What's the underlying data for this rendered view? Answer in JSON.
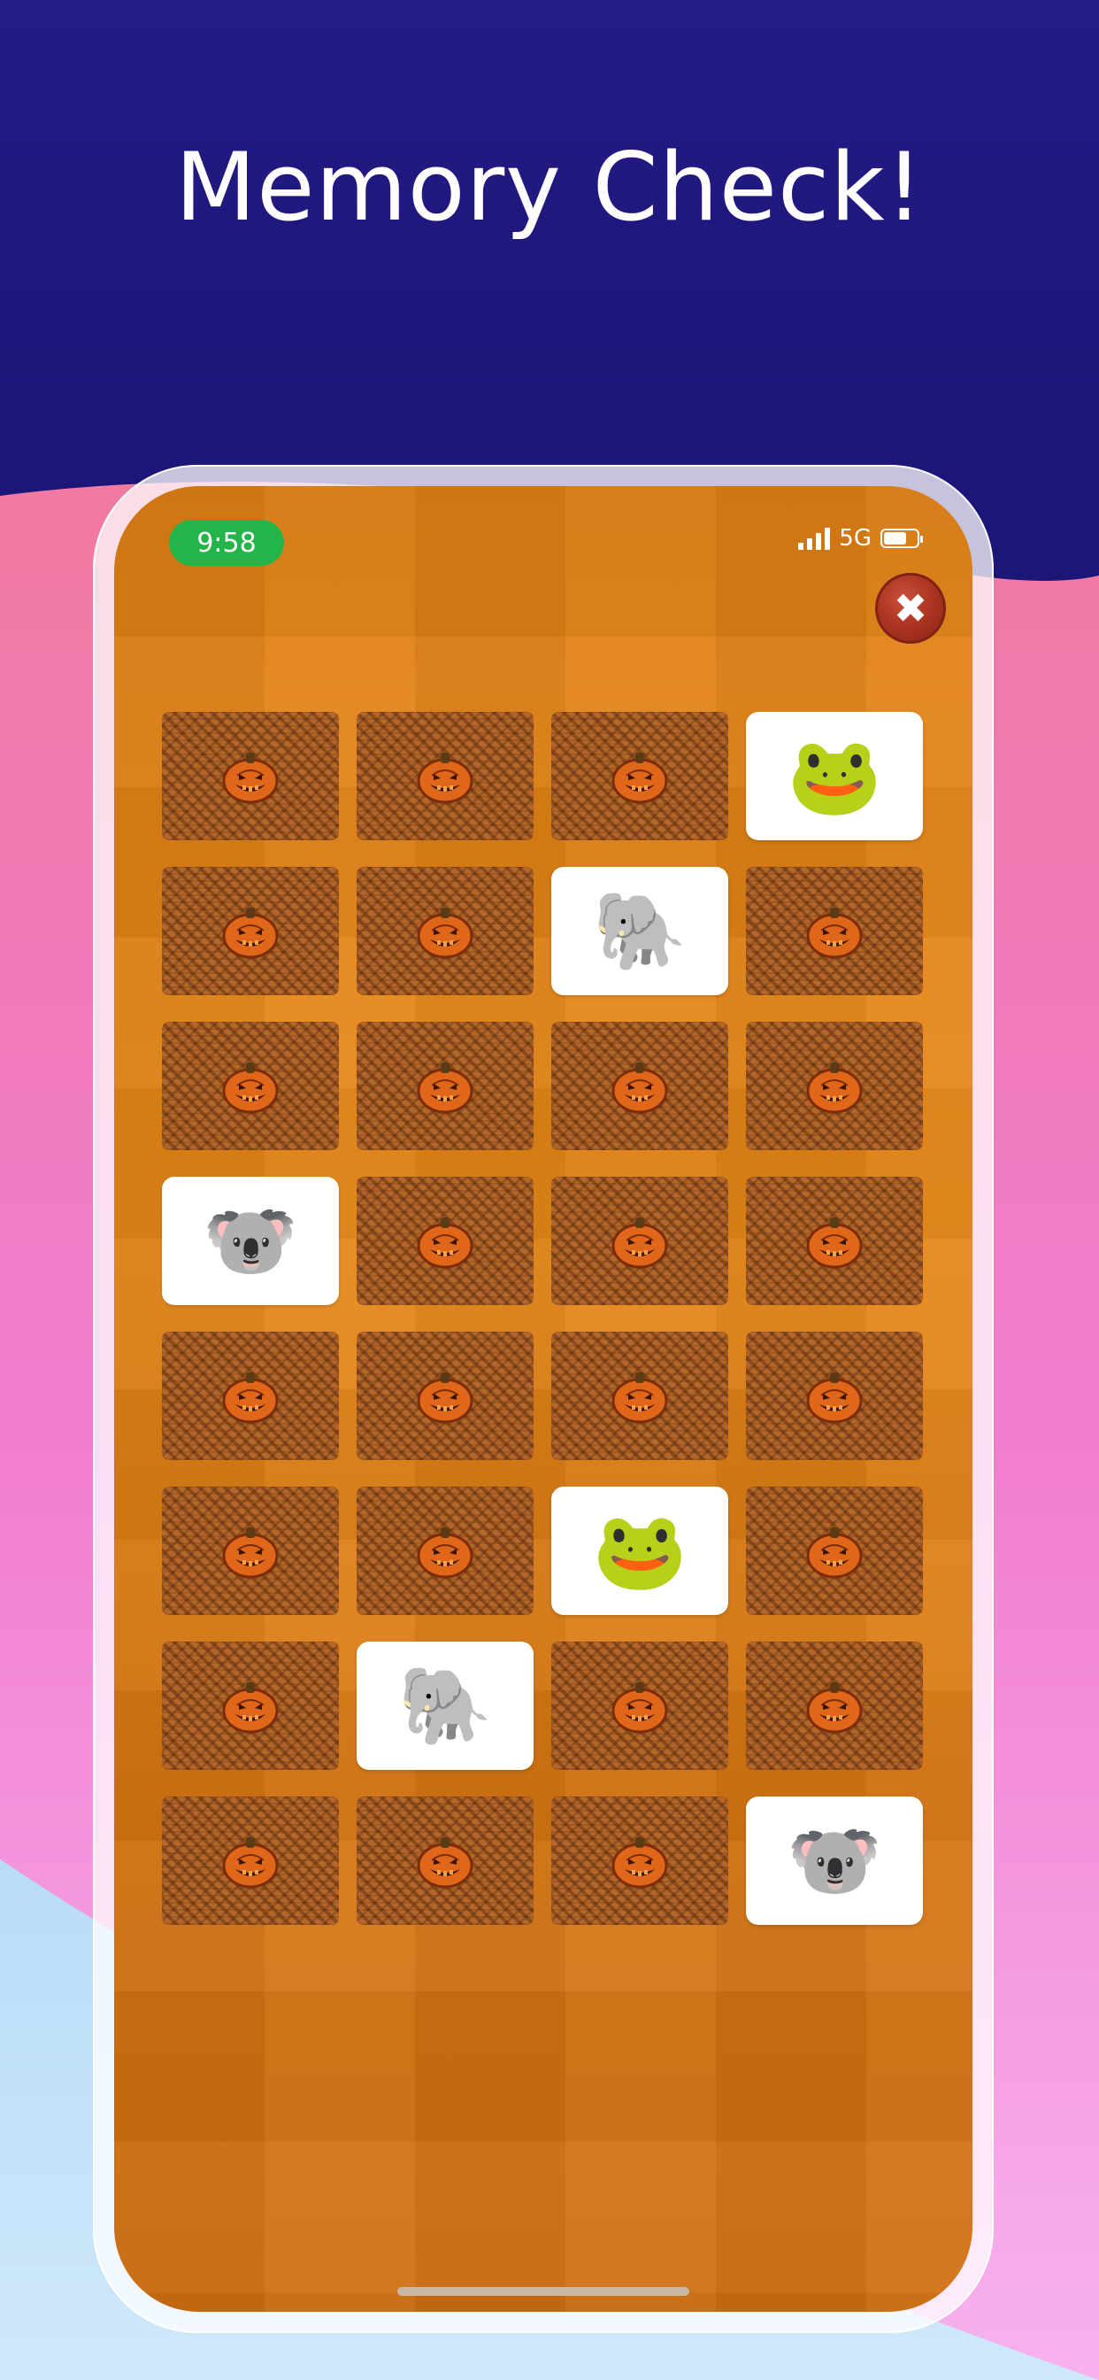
{
  "headline": "Memory Check!",
  "status_bar": {
    "time": "9:58",
    "network": "5G",
    "time_pill_color": "#25b44a",
    "battery_level": 0.7
  },
  "close_button": {
    "icon": "close-icon",
    "glyph": "✖"
  },
  "colors": {
    "background_top": "#1f1a85",
    "screen_orange": "#e3841a",
    "card_face_up": "#ffffff",
    "card_back": "#b5672a"
  },
  "grid": {
    "columns": 4,
    "rows": 8,
    "cards": [
      {
        "state": "down"
      },
      {
        "state": "down"
      },
      {
        "state": "down"
      },
      {
        "state": "up",
        "emoji": "🐸",
        "icon": "frog-icon"
      },
      {
        "state": "down"
      },
      {
        "state": "down"
      },
      {
        "state": "up",
        "emoji": "🐘",
        "icon": "elephant-icon"
      },
      {
        "state": "down"
      },
      {
        "state": "down"
      },
      {
        "state": "down"
      },
      {
        "state": "down"
      },
      {
        "state": "down"
      },
      {
        "state": "up",
        "emoji": "🐨",
        "icon": "koala-icon"
      },
      {
        "state": "down"
      },
      {
        "state": "down"
      },
      {
        "state": "down"
      },
      {
        "state": "down"
      },
      {
        "state": "down"
      },
      {
        "state": "down"
      },
      {
        "state": "down"
      },
      {
        "state": "down"
      },
      {
        "state": "down"
      },
      {
        "state": "up",
        "emoji": "🐸",
        "icon": "frog-icon"
      },
      {
        "state": "down"
      },
      {
        "state": "down"
      },
      {
        "state": "up",
        "emoji": "🐘",
        "icon": "elephant-icon"
      },
      {
        "state": "down"
      },
      {
        "state": "down"
      },
      {
        "state": "down"
      },
      {
        "state": "down"
      },
      {
        "state": "down"
      },
      {
        "state": "up",
        "emoji": "🐨",
        "icon": "koala-icon"
      }
    ],
    "card_back_icon": "pumpkin-icon"
  }
}
